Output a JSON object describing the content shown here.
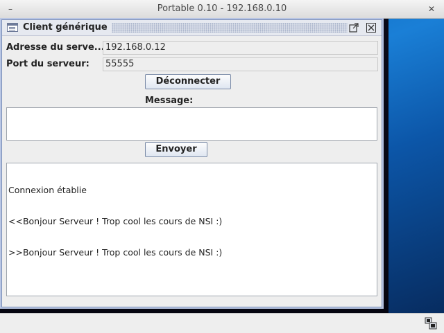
{
  "os_window": {
    "title": "Portable 0.10 - 192.168.0.10",
    "minimize_icon": "–",
    "close_icon": "✕"
  },
  "internal_frame": {
    "title": "Client générique",
    "maximize_icon": "maximize-icon",
    "close_icon": "close-icon"
  },
  "form": {
    "server_address_label": "Adresse du serve...",
    "server_address_value": "192.168.0.12",
    "server_port_label": "Port du serveur:",
    "server_port_value": "55555",
    "disconnect_button": "Déconnecter",
    "message_label": "Message:",
    "message_value": "",
    "send_button": "Envoyer"
  },
  "log": {
    "lines": [
      "Connexion établie",
      "<<Bonjour Serveur ! Trop cool les cours de NSI :)",
      ">>Bonjour Serveur ! Trop cool les cours de NSI :)"
    ]
  }
}
